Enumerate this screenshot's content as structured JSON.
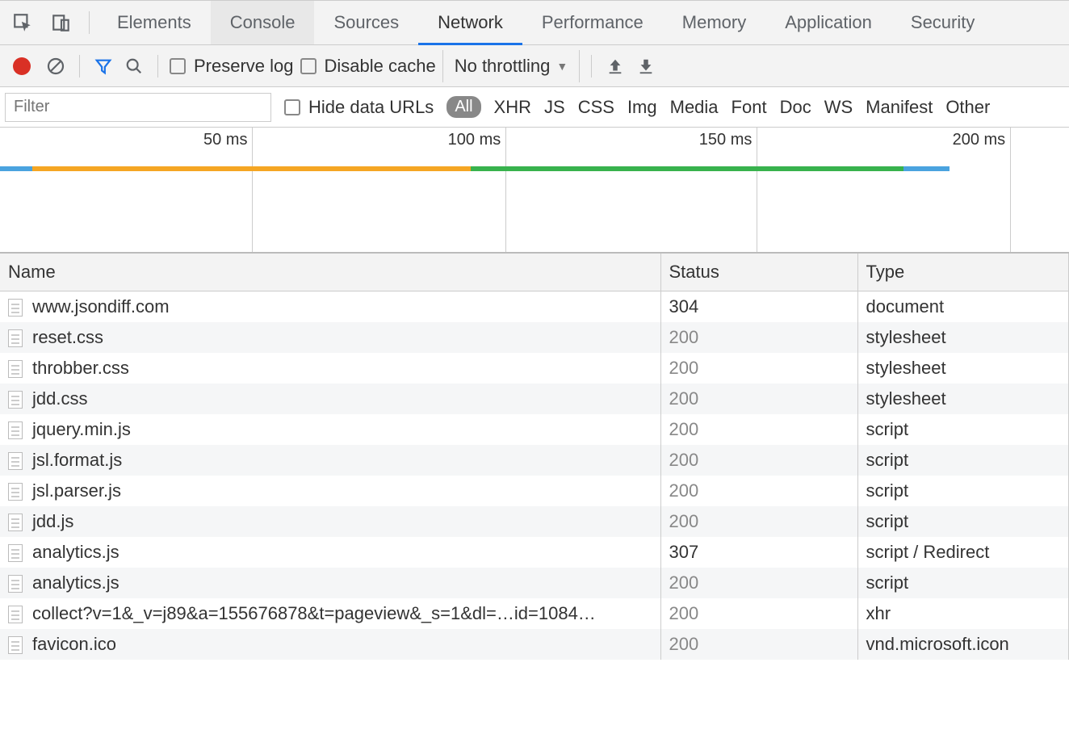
{
  "tabs": {
    "elements": "Elements",
    "console": "Console",
    "sources": "Sources",
    "network": "Network",
    "performance": "Performance",
    "memory": "Memory",
    "application": "Application",
    "security": "Security"
  },
  "toolbar": {
    "preserve_log": "Preserve log",
    "disable_cache": "Disable cache",
    "throttling": "No throttling"
  },
  "filter": {
    "placeholder": "Filter",
    "hide_data_urls": "Hide data URLs",
    "all": "All",
    "xhr": "XHR",
    "js": "JS",
    "css": "CSS",
    "img": "Img",
    "media": "Media",
    "font": "Font",
    "doc": "Doc",
    "ws": "WS",
    "manifest": "Manifest",
    "other": "Other"
  },
  "timeline": {
    "ticks": [
      {
        "label": "50 ms",
        "pos_pct": 23.6
      },
      {
        "label": "100 ms",
        "pos_pct": 47.3
      },
      {
        "label": "150 ms",
        "pos_pct": 70.8
      },
      {
        "label": "200 ms",
        "pos_pct": 94.5
      }
    ],
    "segments": [
      {
        "color": "#4aa3df",
        "start_pct": 0,
        "end_pct": 3
      },
      {
        "color": "#f5a623",
        "start_pct": 3,
        "end_pct": 44.0
      },
      {
        "color": "#38b24d",
        "start_pct": 44.0,
        "end_pct": 84.5
      },
      {
        "color": "#4aa3df",
        "start_pct": 84.5,
        "end_pct": 88.8
      }
    ]
  },
  "columns": {
    "name": "Name",
    "status": "Status",
    "type": "Type"
  },
  "rows": [
    {
      "name": "www.jsondiff.com",
      "status": "304",
      "status_dim": false,
      "type": "document"
    },
    {
      "name": "reset.css",
      "status": "200",
      "status_dim": true,
      "type": "stylesheet"
    },
    {
      "name": "throbber.css",
      "status": "200",
      "status_dim": true,
      "type": "stylesheet"
    },
    {
      "name": "jdd.css",
      "status": "200",
      "status_dim": true,
      "type": "stylesheet"
    },
    {
      "name": "jquery.min.js",
      "status": "200",
      "status_dim": true,
      "type": "script"
    },
    {
      "name": "jsl.format.js",
      "status": "200",
      "status_dim": true,
      "type": "script"
    },
    {
      "name": "jsl.parser.js",
      "status": "200",
      "status_dim": true,
      "type": "script"
    },
    {
      "name": "jdd.js",
      "status": "200",
      "status_dim": true,
      "type": "script"
    },
    {
      "name": "analytics.js",
      "status": "307",
      "status_dim": false,
      "type": "script / Redirect"
    },
    {
      "name": "analytics.js",
      "status": "200",
      "status_dim": true,
      "type": "script"
    },
    {
      "name": "collect?v=1&_v=j89&a=155676878&t=pageview&_s=1&dl=…id=1084…",
      "status": "200",
      "status_dim": true,
      "type": "xhr"
    },
    {
      "name": "favicon.ico",
      "status": "200",
      "status_dim": true,
      "type": "vnd.microsoft.icon"
    }
  ]
}
